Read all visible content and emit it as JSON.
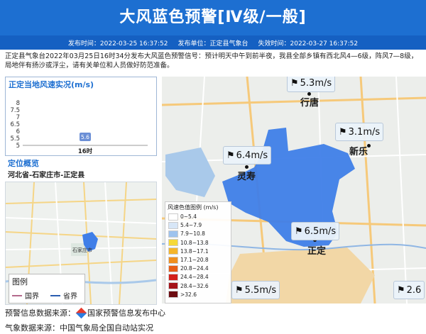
{
  "header": {
    "title": "大风蓝色预警[Ⅳ级/一般]",
    "publish_time": "发布时间：2022-03-25 16:37:52",
    "publisher": "发布单位：正定县气象台",
    "expire_time": "失效时间：2022-03-27 16:37:52"
  },
  "description": "正定县气象台2022年03月25日16时34分发布大风蓝色预警信号：预计明天中午到前半夜，我县全部乡镇有西北风4—6级，阵风7—8级，局地伴有扬沙或浮尘，请有关单位和人员做好防范准备。",
  "wind_panel": {
    "title": "正定当地风速实况(m/s)"
  },
  "chart_data": {
    "type": "scatter",
    "title": "正定当地风速实况(m/s)",
    "categories": [
      "16时"
    ],
    "values": [
      5.6
    ],
    "yticks": [
      "8",
      "7.5",
      "7",
      "6.5",
      "6",
      "5.5",
      "5"
    ],
    "ylim": [
      5,
      8
    ]
  },
  "location": {
    "title": "定位概览",
    "path": "河北省-石家庄市-正定县",
    "legend_title": "图例",
    "legend_items": [
      {
        "label": "国界",
        "color": "#b46a8c"
      },
      {
        "label": "省界",
        "color": "#2a5db0"
      }
    ],
    "minimap_city": "石家庄市"
  },
  "map": {
    "legend_title": "风速色值图例 (m/s)",
    "legend_items": [
      {
        "label": "0~5.4",
        "color": "#ffffff"
      },
      {
        "label": "5.4~7.9",
        "color": "#d7e6f7"
      },
      {
        "label": "7.9~10.8",
        "color": "#9ec3ee"
      },
      {
        "label": "10.8~13.8",
        "color": "#f5d93a"
      },
      {
        "label": "13.8~17.1",
        "color": "#f5b52a"
      },
      {
        "label": "17.1~20.8",
        "color": "#f08f1e"
      },
      {
        "label": "20.8~24.4",
        "color": "#e85e16"
      },
      {
        "label": "24.4~28.4",
        "color": "#d3201a"
      },
      {
        "label": "28.4~32.6",
        "color": "#a5141a"
      },
      {
        "label": ">32.6",
        "color": "#6e0d12"
      }
    ],
    "stations": [
      {
        "value": "5.3m/s",
        "name": "station-xingtang-n"
      },
      {
        "value": "3.1m/s",
        "name": "station-xinle"
      },
      {
        "value": "6.4m/s",
        "name": "station-lingshou"
      },
      {
        "value": "6.5m/s",
        "name": "station-zhengding"
      },
      {
        "value": "5.5m/s",
        "name": "station-south"
      },
      {
        "value": "2.6",
        "name": "station-east"
      }
    ],
    "cities": [
      "行唐",
      "新乐",
      "灵寿",
      "正定"
    ],
    "region_color": "#3f7ee8"
  },
  "footer": {
    "warning_source": "预警信息数据来源：",
    "warning_source_name": "国家预警信息发布中心",
    "weather_source": "气象数据来源：中国气象局全国自动站实况"
  }
}
